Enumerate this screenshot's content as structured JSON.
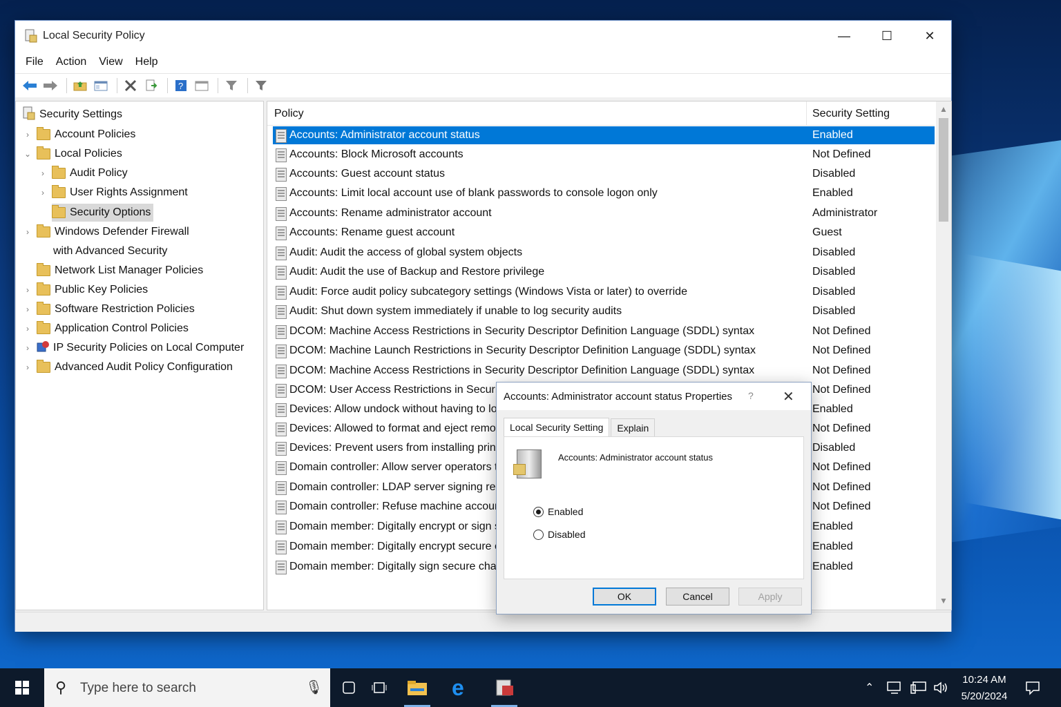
{
  "window": {
    "title": "Local Security Policy",
    "minimize": "—",
    "maximize": "☐",
    "close": "✕"
  },
  "menu": [
    "File",
    "Action",
    "View",
    "Help"
  ],
  "tree": {
    "root": "Security Settings",
    "items": [
      {
        "label": "Account Policies",
        "chevron": "›"
      },
      {
        "label": "Local Policies",
        "chevron": "⌄"
      },
      {
        "label": "Audit Policy",
        "chevron": "›"
      },
      {
        "label": "User Rights Assignment",
        "chevron": "›"
      },
      {
        "label": "Security Options",
        "chevron": ""
      },
      {
        "label": "Windows Defender Firewall",
        "chevron": "›"
      },
      {
        "label": "with Advanced Security",
        "chevron": ""
      },
      {
        "label": "Network List Manager Policies",
        "chevron": ""
      },
      {
        "label": "Public Key Policies",
        "chevron": "›"
      },
      {
        "label": "Software Restriction Policies",
        "chevron": "›"
      },
      {
        "label": "Application Control Policies",
        "chevron": "›"
      },
      {
        "label": "IP Security Policies on Local Computer",
        "chevron": "›"
      },
      {
        "label": "Advanced Audit Policy Configuration",
        "chevron": "›"
      }
    ]
  },
  "list": {
    "col_policy": "Policy",
    "col_setting": "Security Setting",
    "rows": [
      {
        "policy": "Accounts: Administrator account status",
        "setting": "Enabled"
      },
      {
        "policy": "Accounts: Block Microsoft accounts",
        "setting": "Not Defined"
      },
      {
        "policy": "Accounts: Guest account status",
        "setting": "Disabled"
      },
      {
        "policy": "Accounts: Limit local account use of blank passwords to console logon only",
        "setting": "Enabled"
      },
      {
        "policy": "Accounts: Rename administrator account",
        "setting": "Administrator"
      },
      {
        "policy": "Accounts: Rename guest account",
        "setting": "Guest"
      },
      {
        "policy": "Audit: Audit the access of global system objects",
        "setting": "Disabled"
      },
      {
        "policy": "Audit: Audit the use of Backup and Restore privilege",
        "setting": "Disabled"
      },
      {
        "policy": "Audit: Force audit policy subcategory settings (Windows Vista or later) to override",
        "setting": "Disabled"
      },
      {
        "policy": "Audit: Shut down system immediately if unable to log security audits",
        "setting": "Disabled"
      },
      {
        "policy": "DCOM: Machine Access Restrictions in Security Descriptor Definition Language (SDDL) syntax",
        "setting": "Not Defined"
      },
      {
        "policy": "DCOM: Machine Launch Restrictions in Security Descriptor Definition Language (SDDL) syntax",
        "setting": "Not Defined"
      },
      {
        "policy": "DCOM: Machine Access Restrictions in Security Descriptor Definition Language (SDDL) syntax",
        "setting": "Not Defined"
      },
      {
        "policy": "DCOM: User Access Restrictions in Security",
        "setting": "Not Defined"
      },
      {
        "policy": "Devices: Allow undock without having to log",
        "setting": "Enabled"
      },
      {
        "policy": "Devices: Allowed to format and eject remov",
        "setting": "Not Defined"
      },
      {
        "policy": "Devices: Prevent users from installing printe",
        "setting": "Disabled"
      },
      {
        "policy": "Domain controller: Allow server operators to",
        "setting": "Not Defined"
      },
      {
        "policy": "Domain controller: LDAP server signing requ",
        "setting": "Not Defined"
      },
      {
        "policy": "Domain controller: Refuse machine account",
        "setting": "Not Defined"
      },
      {
        "policy": "Domain member: Digitally encrypt or sign s",
        "setting": "Enabled"
      },
      {
        "policy": "Domain member: Digitally encrypt secure ch",
        "setting": "Enabled"
      },
      {
        "policy": "Domain member: Digitally sign secure chanr",
        "setting": "Enabled"
      }
    ]
  },
  "dialog": {
    "title": "Accounts: Administrator account status Properties",
    "help": "?",
    "close": "✕",
    "tabs": [
      "Local Security Setting",
      "Explain"
    ],
    "policy_name": "Accounts: Administrator account status",
    "options": [
      "Enabled",
      "Disabled"
    ],
    "selected_option": "Enabled",
    "ok": "OK",
    "cancel": "Cancel",
    "apply": "Apply"
  },
  "taskbar": {
    "search_placeholder": "Type here to search",
    "time": "10:24 AM",
    "date": "5/20/2024"
  },
  "colors": {
    "selection": "#0078d7",
    "taskbar": "#0d1a2b"
  }
}
